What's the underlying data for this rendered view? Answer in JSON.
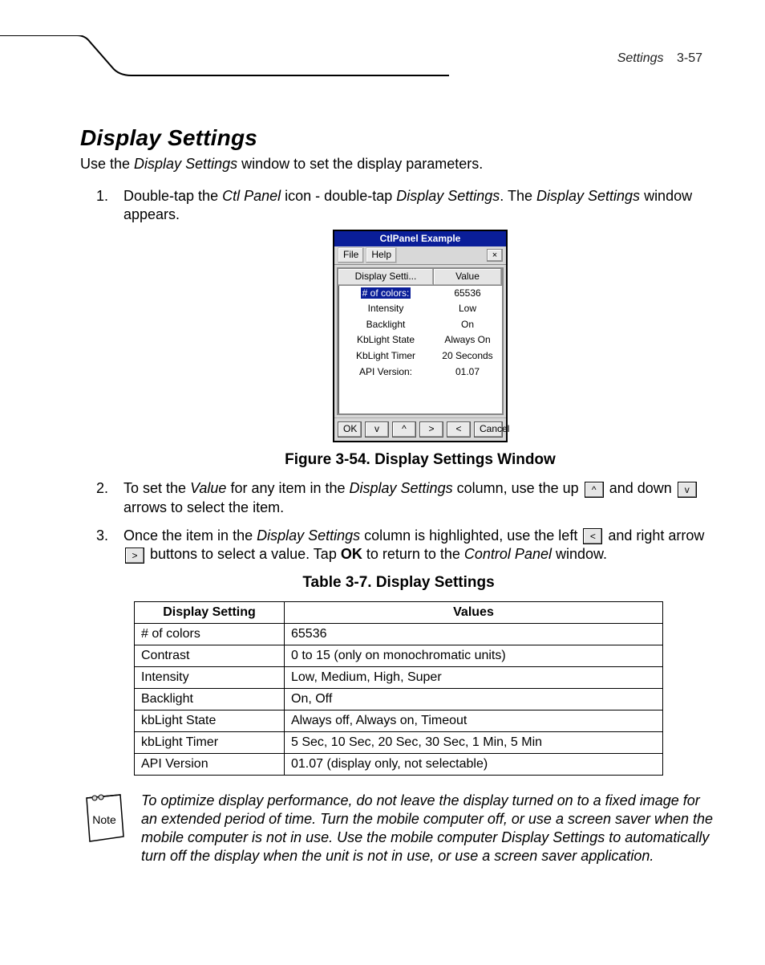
{
  "running_head": {
    "label": "Settings",
    "page": "3-57"
  },
  "h2": "Display Settings",
  "lead": {
    "pre": "Use the ",
    "em": "Display Settings",
    "post": " window to set the display parameters."
  },
  "step1": {
    "a": "Double-tap the ",
    "em1": "Ctl Panel",
    "b": " icon - double-tap ",
    "em2": "Display Settings",
    "c": ". The ",
    "em3": "Display Settings",
    "d": " window appears."
  },
  "window": {
    "title": "CtlPanel Example",
    "menu": {
      "file": "File",
      "help": "Help",
      "close": "×"
    },
    "head": {
      "col1": "Display Setti...",
      "col2": "Value"
    },
    "rows": [
      {
        "label": "# of colors:",
        "value": "65536",
        "selected": true
      },
      {
        "label": "Intensity",
        "value": "Low"
      },
      {
        "label": "Backlight",
        "value": "On"
      },
      {
        "label": "KbLight State",
        "value": "Always On"
      },
      {
        "label": "KbLight Timer",
        "value": "20 Seconds"
      },
      {
        "label": "API Version:",
        "value": "01.07"
      }
    ],
    "buttons": {
      "ok": "OK",
      "down": "v",
      "up": "^",
      "right": ">",
      "left": "<",
      "cancel": "Cancel"
    }
  },
  "figure_caption": "Figure 3-54.  Display Settings Window",
  "step2": {
    "a": "To set the ",
    "em1": "Value",
    "b": " for any item in the ",
    "em2": "Display Settings",
    "c": " column, use the up ",
    "d": " and down ",
    "e": " arrows to select the item."
  },
  "step3": {
    "a": "Once the item in the ",
    "em1": "Display Settings",
    "b": " column is highlighted, use the left ",
    "c": " and right arrow ",
    "d": " buttons to select a value. Tap ",
    "ok": "OK",
    "e": " to return to the ",
    "em2": "Control Panel",
    "f": " window."
  },
  "inline_keys": {
    "up": "^",
    "down": "v",
    "left": "<",
    "right": ">"
  },
  "table_caption": "Table 3-7. Display Settings",
  "table": {
    "head": {
      "col1": "Display Setting",
      "col2": "Values"
    },
    "rows": [
      {
        "setting": "# of colors",
        "values": "65536"
      },
      {
        "setting": "Contrast",
        "values": "0 to 15 (only on monochromatic units)"
      },
      {
        "setting": "Intensity",
        "values": "Low, Medium, High, Super"
      },
      {
        "setting": "Backlight",
        "values": "On, Off"
      },
      {
        "setting": "kbLight State",
        "values": "Always off, Always on, Timeout"
      },
      {
        "setting": "kbLight Timer",
        "values": "5 Sec, 10 Sec, 20 Sec, 30 Sec, 1 Min, 5 Min"
      },
      {
        "setting": "API Version",
        "values": " 01.07 (display only, not selectable)"
      }
    ]
  },
  "note_label": "Note",
  "note_text": "To optimize display performance, do not leave the display turned on to a fixed image for an extended period of time.  Turn the mobile computer off, or use a screen saver when the mobile computer is not in use. Use the mobile computer Display Settings to automatically turn off the display when the unit is not in use, or use a screen saver application."
}
